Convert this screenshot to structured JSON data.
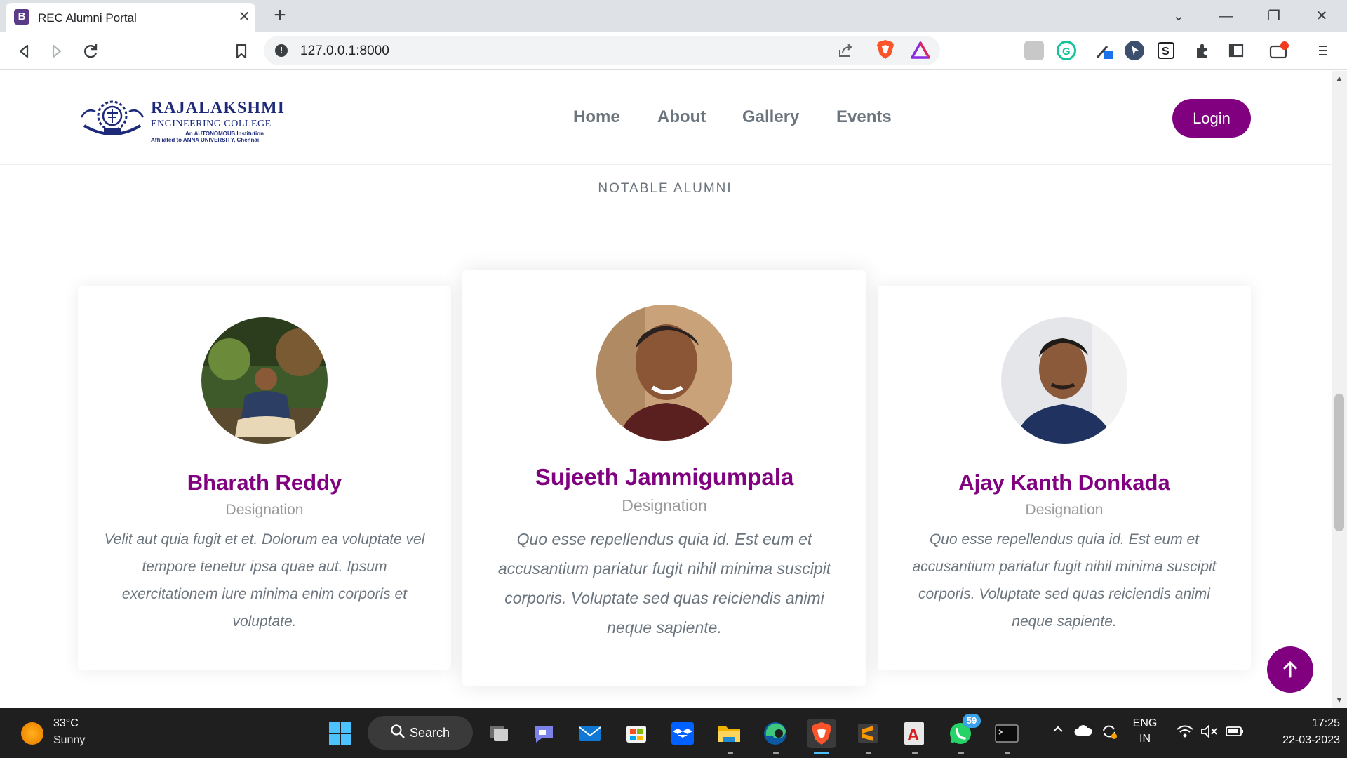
{
  "browser": {
    "tab_title": "REC Alumni Portal",
    "tab_favicon_letter": "B",
    "url": "127.0.0.1:8000"
  },
  "site": {
    "logo": {
      "title": "RAJALAKSHMI",
      "subtitle": "ENGINEERING COLLEGE",
      "line3": "An AUTONOMOUS Institution",
      "line4": "Affiliated to ANNA UNIVERSITY, Chennai"
    },
    "nav": [
      {
        "label": "Home"
      },
      {
        "label": "About"
      },
      {
        "label": "Gallery"
      },
      {
        "label": "Events"
      }
    ],
    "login_label": "Login",
    "section_title": "NOTABLE ALUMNI",
    "brand_color": "#800080",
    "alumni": [
      {
        "name": "Bharath Reddy",
        "designation": "Designation",
        "quote": "Velit aut quia fugit et et. Dolorum ea voluptate vel tempore tenetur ipsa quae aut. Ipsum exercitationem iure minima enim corporis et voluptate."
      },
      {
        "name": "Sujeeth Jammigumpala",
        "designation": "Designation",
        "quote": "Quo esse repellendus quia id. Est eum et accusantium pariatur fugit nihil minima suscipit corporis. Voluptate sed quas reiciendis animi neque sapiente."
      },
      {
        "name": "Ajay Kanth Donkada",
        "designation": "Designation",
        "quote": "Quo esse repellendus quia id. Est eum et accusantium pariatur fugit nihil minima suscipit corporis. Voluptate sed quas reiciendis animi neque sapiente."
      }
    ]
  },
  "taskbar": {
    "weather_temp": "33°C",
    "weather_condition": "Sunny",
    "search_label": "Search",
    "whatsapp_badge": "59",
    "language": "ENG",
    "region": "IN",
    "time": "17:25",
    "date": "22-03-2023"
  }
}
